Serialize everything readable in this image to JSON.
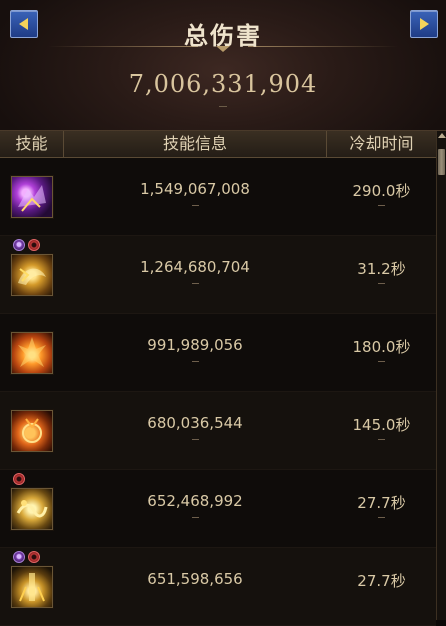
{
  "header": {
    "title": "总伤害",
    "total": "7,006,331,904",
    "prev_icon": "arrow-left-icon",
    "next_icon": "arrow-right-icon"
  },
  "columns": {
    "skill": "技能",
    "info": "技能信息",
    "cooldown": "冷却时间"
  },
  "colors": {
    "accent_button": "#2d4fa3",
    "arrow": "#f4d35a",
    "text": "#d9c9a6"
  },
  "rows": [
    {
      "icon": "purple-fist-skill-icon",
      "damage": "1,549,067,008",
      "cooldown": "290.0秒",
      "badges": []
    },
    {
      "icon": "golden-dragon-skill-icon",
      "damage": "1,264,680,704",
      "cooldown": "31.2秒",
      "badges": [
        "rune-purple-icon",
        "rune-red-icon"
      ]
    },
    {
      "icon": "flame-burst-skill-icon",
      "damage": "991,989,056",
      "cooldown": "180.0秒",
      "badges": []
    },
    {
      "icon": "fire-orb-skill-icon",
      "damage": "680,036,544",
      "cooldown": "145.0秒",
      "badges": []
    },
    {
      "icon": "golden-wave-skill-icon",
      "damage": "652,468,992",
      "cooldown": "27.7秒",
      "badges": [
        "rune-red-icon"
      ]
    },
    {
      "icon": "golden-pillar-skill-icon",
      "damage": "651,598,656",
      "cooldown": "27.7秒",
      "badges": [
        "rune-purple-icon",
        "rune-red-icon"
      ]
    }
  ]
}
